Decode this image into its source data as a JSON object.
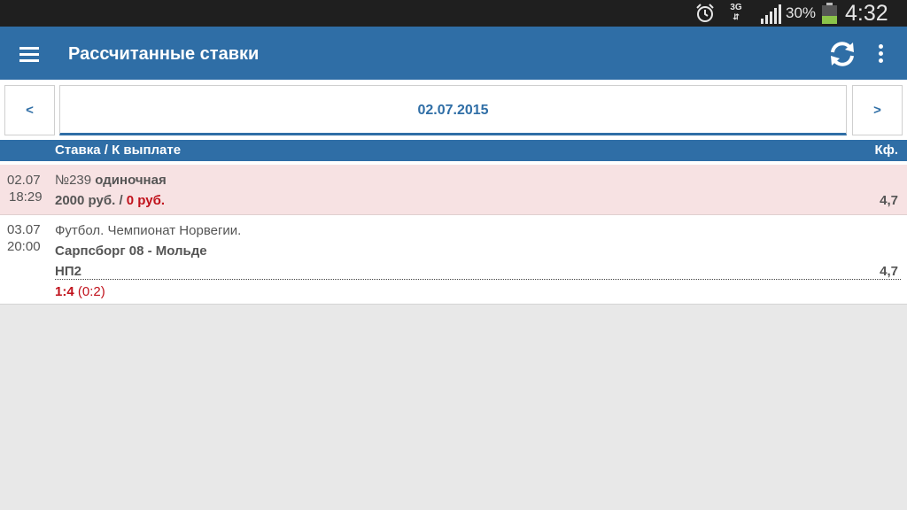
{
  "status_bar": {
    "network": "3G",
    "network_arrows": "⇵",
    "battery_percent": "30%",
    "time": "4:32",
    "icons": [
      "alarm-icon",
      "signal-icon",
      "battery-icon"
    ]
  },
  "app_bar": {
    "title": "Рассчитанные ставки",
    "icons": [
      "menu-icon",
      "refresh-icon",
      "overflow-menu-icon"
    ]
  },
  "date_nav": {
    "prev_label": "<",
    "date": "02.07.2015",
    "next_label": ">"
  },
  "table_header": {
    "stake_label": "Ставка / К выплате",
    "coef_label": "Кф."
  },
  "bet": {
    "date": "02.07",
    "time": "18:29",
    "number": "№239",
    "type": "одиночная",
    "stake": "2000 руб.",
    "separator": "/",
    "payout": "0 руб.",
    "coef": "4,7"
  },
  "event": {
    "date": "03.07",
    "time": "20:00",
    "league": "Футбол. Чемпионат Норвегии.",
    "match": "Сарпсборг 08 - Мольде",
    "outcome": "НП2",
    "coef": "4,7",
    "score": "1:4",
    "half_score": "(0:2)"
  },
  "colors": {
    "primary": "#2f6ea6",
    "status_bar": "#1f1f1f",
    "bet_row_bg": "#f7e2e3",
    "loss_red": "#c0111b"
  }
}
